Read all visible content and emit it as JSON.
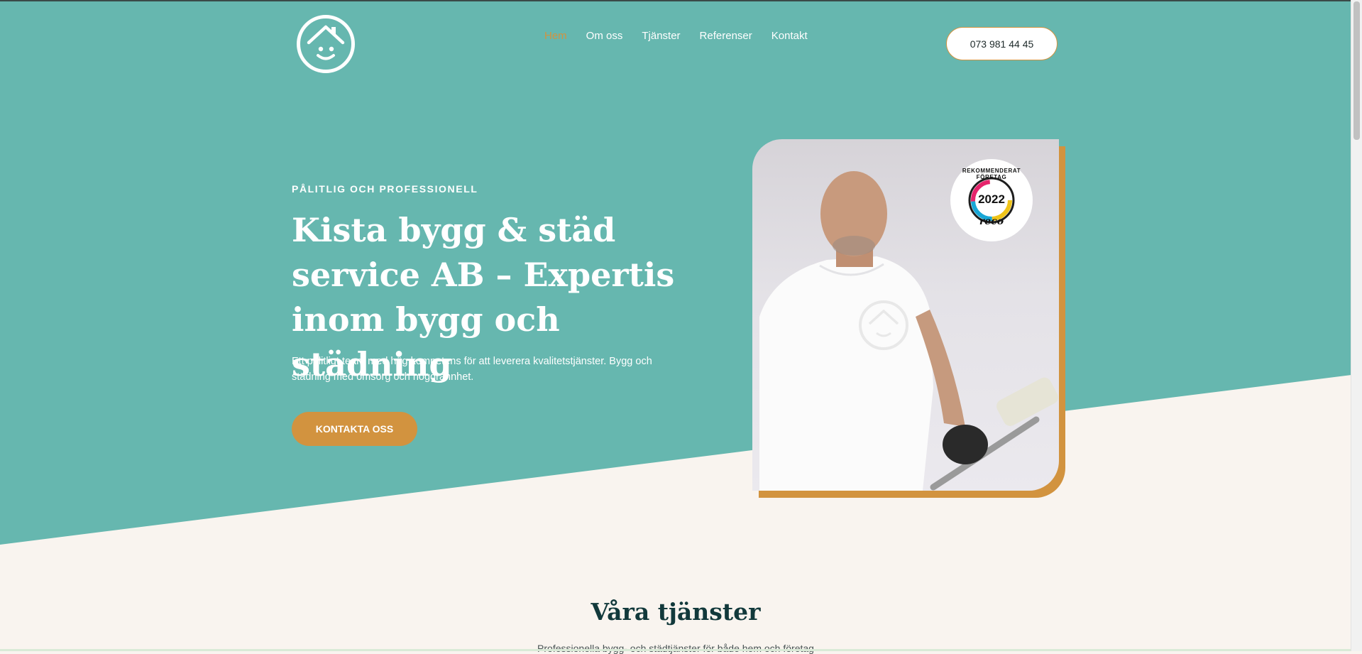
{
  "header": {
    "nav": [
      {
        "label": "Hem",
        "active": true
      },
      {
        "label": "Om oss"
      },
      {
        "label": "Tjänster"
      },
      {
        "label": "Referenser"
      },
      {
        "label": "Kontakt"
      }
    ],
    "phone": "073 981 44 45"
  },
  "hero": {
    "eyebrow": "PÅLITLIG OCH PROFESSIONELL",
    "title": "Kista bygg & städ service AB – Expertis inom bygg och städning",
    "description": "Ett pålitligt team med hög kompetens för att leverera kvalitetstjänster. Bygg och städning med omsorg och noggrannhet.",
    "cta": "KONTAKTA OSS",
    "badge": {
      "top_text": "REKOMMENDERAT FÖRETAG",
      "year": "2022",
      "brand": "reco"
    }
  },
  "services": {
    "title": "Våra tjänster",
    "subtitle": "Professionella bygg- och städtjänster för både hem och företag"
  },
  "colors": {
    "teal": "#66b7af",
    "accent": "#d2933f",
    "cream": "#f9f4ef",
    "dark": "#12393b"
  },
  "icons": [
    "house-smile-logo-icon",
    "house-smile-watermark-icon"
  ]
}
